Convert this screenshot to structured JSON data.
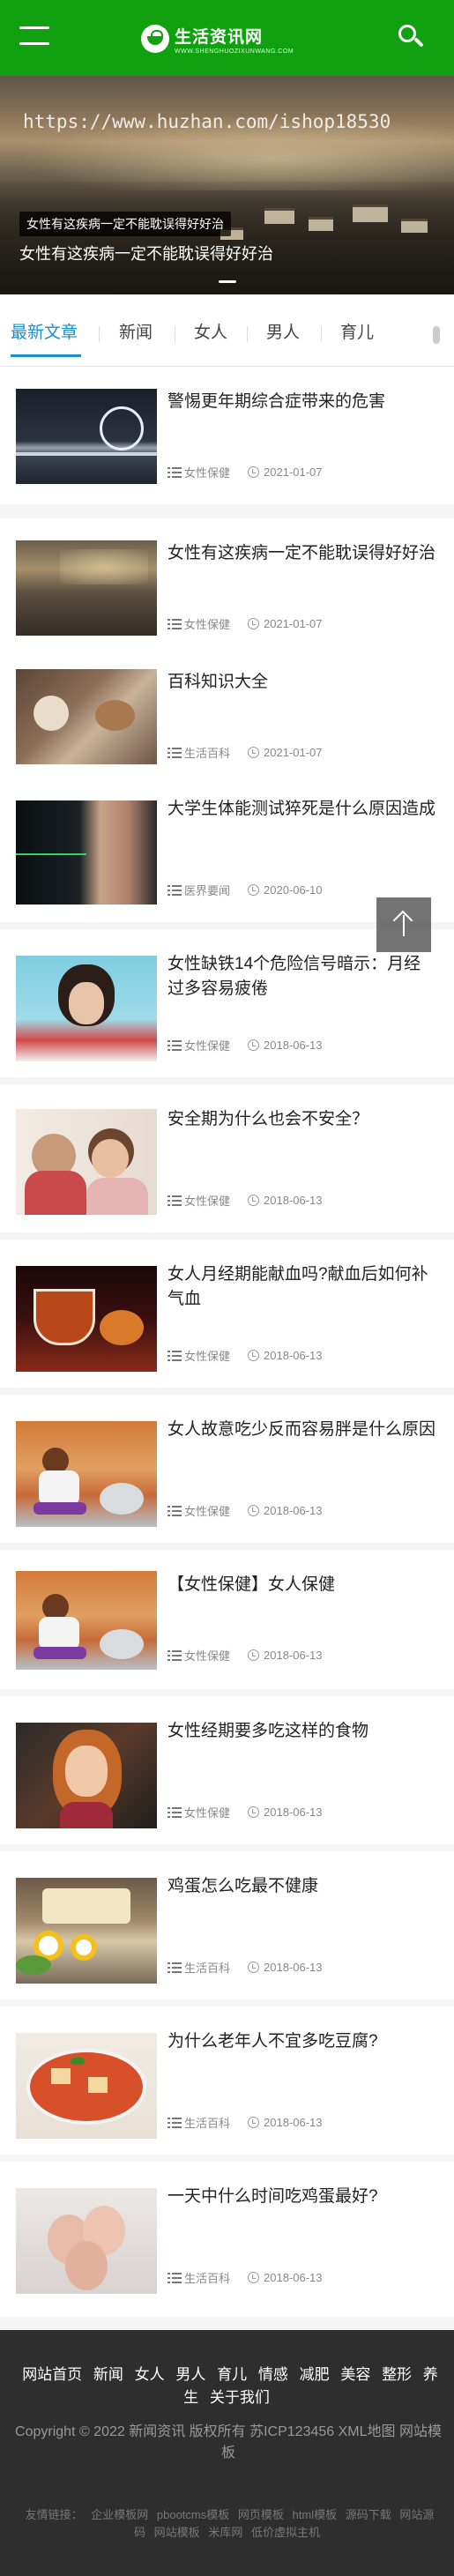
{
  "header": {
    "logo_title": "生活资讯网",
    "logo_sub": "WWW.SHENGHUOZIXUNWANG.COM"
  },
  "banner": {
    "watermark": "https://www.huzhan.com/ishop18530",
    "tag": "女性有这疾病一定不能耽误得好好治",
    "caption": "女性有这疾病一定不能耽误得好好治"
  },
  "tabs": [
    "最新文章",
    "新闻",
    "女人",
    "男人",
    "育儿"
  ],
  "articles": [
    {
      "title": "警惕更年期综合症带来的危害",
      "category": "女性保健",
      "date": "2021-01-07"
    },
    {
      "title": "女性有这疾病一定不能耽误得好好治",
      "category": "女性保健",
      "date": "2021-01-07"
    },
    {
      "title": "百科知识大全",
      "category": "生活百科",
      "date": "2021-01-07"
    },
    {
      "title": "大学生体能测试猝死是什么原因造成",
      "category": "医界要闻",
      "date": "2020-06-10"
    },
    {
      "title": "女性缺铁14个危险信号暗示：月经过多容易疲倦",
      "category": "女性保健",
      "date": "2018-06-13"
    },
    {
      "title": "安全期为什么也会不安全？",
      "category": "女性保健",
      "date": "2018-06-13"
    },
    {
      "title": "女人月经期能献血吗?献血后如何补气血",
      "category": "女性保健",
      "date": "2018-06-13"
    },
    {
      "title": "女人故意吃少反而容易胖是什么原因",
      "category": "女性保健",
      "date": "2018-06-13"
    },
    {
      "title": "【女性保健】女人保健",
      "category": "女性保健",
      "date": "2018-06-13"
    },
    {
      "title": "女性经期要多吃这样的食物",
      "category": "女性保健",
      "date": "2018-06-13"
    },
    {
      "title": "鸡蛋怎么吃最不健康",
      "category": "生活百科",
      "date": "2018-06-13"
    },
    {
      "title": "为什么老年人不宜多吃豆腐?",
      "category": "生活百科",
      "date": "2018-06-13"
    },
    {
      "title": "一天中什么时间吃鸡蛋最好?",
      "category": "生活百科",
      "date": "2018-06-13"
    }
  ],
  "footer": {
    "nav": [
      "网站首页",
      "新闻",
      "女人",
      "男人",
      "育儿",
      "情感",
      "减肥",
      "美容",
      "整形",
      "养生",
      "关于我们"
    ],
    "copyright": "Copyright © 2022 新闻资讯 版权所有 苏ICP123456 XML地图 网站模板",
    "links_label": "友情链接：",
    "links": [
      "企业模板网",
      "pbootcms模板",
      "网页模板",
      "html模板",
      "源码下载",
      "网站源码",
      "网站模板",
      "米库网",
      "低价虚拟主机"
    ]
  },
  "colors": {
    "header_bg": "#10a010",
    "tab_active": "#1a8fd1",
    "footer_bg": "#2e2e2e"
  },
  "icons": {
    "menu": "hamburger-menu-icon",
    "search": "search-icon",
    "category": "list-icon",
    "date": "clock-icon",
    "back_to_top": "arrow-up-icon"
  }
}
